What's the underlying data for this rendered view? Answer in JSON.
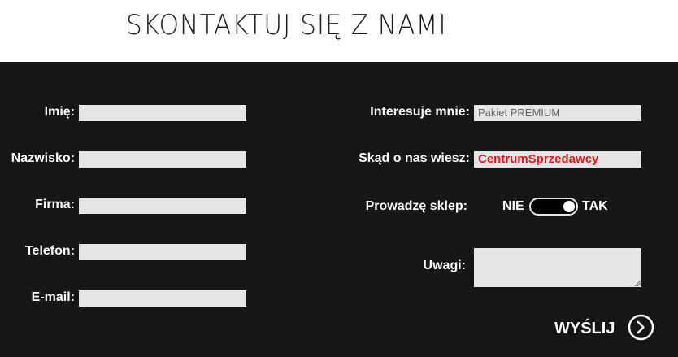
{
  "title": "SKONTAKTUJ SIĘ Z NAMI",
  "left_fields": [
    {
      "label": "Imię:",
      "value": ""
    },
    {
      "label": "Nazwisko:",
      "value": ""
    },
    {
      "label": "Firma:",
      "value": ""
    },
    {
      "label": "Telefon:",
      "value": ""
    },
    {
      "label": "E-mail:",
      "value": ""
    }
  ],
  "interest": {
    "label": "Interesuje mnie:",
    "value": "Pakiet PREMIUM"
  },
  "source": {
    "label": "Skąd o nas wiesz:",
    "value": "CentrumSprzedawcy"
  },
  "shop": {
    "label": "Prowadzę sklep:",
    "off_label": "NIE",
    "on_label": "TAK",
    "checked": true
  },
  "notes": {
    "label": "Uwagi:",
    "value": ""
  },
  "submit_label": "WYŚLIJ",
  "colors": {
    "panel_bg": "#161616",
    "field_bg": "#e5e5e5",
    "accent_red": "#e3161b"
  }
}
